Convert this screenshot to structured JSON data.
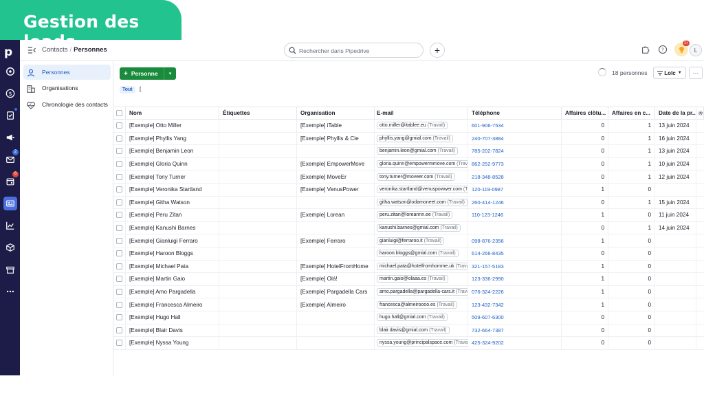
{
  "banner": {
    "title": "Gestion des leads"
  },
  "rail": {
    "logo": "p",
    "badges": {
      "mail": "2",
      "calendar": "6"
    }
  },
  "topbar": {
    "breadcrumb_parent": "Contacts",
    "breadcrumb_sep": "/",
    "breadcrumb_current": "Personnes",
    "search_placeholder": "Rechercher dans Pipedrive",
    "plus_label": "+",
    "bulb_badge": "1+",
    "avatar_initial": "L"
  },
  "sidenav": {
    "items": [
      {
        "label": "Personnes",
        "icon": "person-icon"
      },
      {
        "label": "Organisations",
        "icon": "building-icon"
      },
      {
        "label": "Chronologie des contacts",
        "icon": "heart-pulse-icon"
      }
    ]
  },
  "toolbar": {
    "add_plus": "+",
    "add_label": "Personne",
    "add_caret": "▾",
    "filter_tag": "Tout",
    "filter_cursor": "[",
    "count_label": "18 personnes",
    "owner_label": "Loïc",
    "more_label": "···"
  },
  "table": {
    "headers": {
      "nom": "Nom",
      "etiquettes": "Étiquettes",
      "organisation": "Organisation",
      "email": "E-mail",
      "telephone": "Téléphone",
      "affaires_cloturees": "Affaires clôtu...",
      "affaires_en_cours": "Affaires en c...",
      "date": "Date de la pr..."
    },
    "rows": [
      {
        "nom": "[Exemple] Otto Miller",
        "org": "[Exemple] iTable",
        "email": "otto.miller@itablee.eu",
        "email_tag": "(Travail)",
        "tel": "601-906-7534",
        "closed": "0",
        "open": "1",
        "date": "13 juin 2024"
      },
      {
        "nom": "[Exemple] Phyllis Yang",
        "org": "[Exemple] Phyllis & Cie",
        "email": "phyllis.yang@gmial.com",
        "email_tag": "(Travail)",
        "tel": "240-707-3884",
        "closed": "0",
        "open": "1",
        "date": "16 juin 2024"
      },
      {
        "nom": "[Exemple] Benjamin Leon",
        "org": "",
        "email": "benjamin.leon@gmial.com",
        "email_tag": "(Travail)",
        "tel": "785-202-7824",
        "closed": "0",
        "open": "1",
        "date": "13 juin 2024"
      },
      {
        "nom": "[Exemple] Gloria Quinn",
        "org": "[Exemple] EmpowerMove",
        "email": "gloria.quinn@empowermmove.com",
        "email_tag": "(Travail)",
        "tel": "862-252-9773",
        "closed": "0",
        "open": "1",
        "date": "10 juin 2024"
      },
      {
        "nom": "[Exemple] Tony Turner",
        "org": "[Exemple] MoveEr",
        "email": "tony.turner@moveer.com",
        "email_tag": "(Travail)",
        "tel": "218-348-8528",
        "closed": "0",
        "open": "1",
        "date": "12 juin 2024"
      },
      {
        "nom": "[Exemple] Veronika Startland",
        "org": "[Exemple] VenusPower",
        "email": "veronika.startland@venuspowwer.com",
        "email_tag": "(Travail)",
        "tel": "120-119-0987",
        "closed": "1",
        "open": "0",
        "date": ""
      },
      {
        "nom": "[Exemple] Githa Watson",
        "org": "",
        "email": "githa.watson@odamoneet.com",
        "email_tag": "(Travail)",
        "tel": "260-414-1246",
        "closed": "0",
        "open": "1",
        "date": "15 juin 2024"
      },
      {
        "nom": "[Exemple] Peru Zitan",
        "org": "[Exemple] Lorean",
        "email": "peru.zitan@loreannn.ee",
        "email_tag": "(Travail)",
        "tel": "110-123-1246",
        "closed": "1",
        "open": "0",
        "date": "11 juin 2024"
      },
      {
        "nom": "[Exemple] Kanushi Barnes",
        "org": "",
        "email": "kanushi.barnes@gmial.com",
        "email_tag": "(Travail)",
        "tel": "",
        "closed": "0",
        "open": "1",
        "date": "14 juin 2024"
      },
      {
        "nom": "[Exemple] Gianluigi Ferraro",
        "org": "[Exemple] Ferraro",
        "email": "gianluigi@ferraroo.it",
        "email_tag": "(Travail)",
        "tel": "098-876-2356",
        "closed": "1",
        "open": "0",
        "date": ""
      },
      {
        "nom": "[Exemple] Haroon Bloggs",
        "org": "",
        "email": "haroon.bloggs@gmial.com",
        "email_tag": "(Travail)",
        "tel": "614-266-8435",
        "closed": "0",
        "open": "0",
        "date": ""
      },
      {
        "nom": "[Exemple] Michael Pata",
        "org": "[Exemple] HotelFromHome",
        "email": "michael.pata@hotelfromhomme.uk",
        "email_tag": "(Travail)",
        "tel": "321-157-5183",
        "closed": "1",
        "open": "0",
        "date": ""
      },
      {
        "nom": "[Exemple] Martin Gaio",
        "org": "[Exemple] Olá!",
        "email": "martin.gaio@olaaa.es",
        "email_tag": "(Travail)",
        "tel": "123-336-2990",
        "closed": "1",
        "open": "0",
        "date": ""
      },
      {
        "nom": "[Exemple] Amo Pargadella",
        "org": "[Exemple] Pargadella Cars",
        "email": "amo.pargadella@pargadella-cars.it",
        "email_tag": "(Travail)",
        "tel": "076-324-2226",
        "closed": "1",
        "open": "0",
        "date": ""
      },
      {
        "nom": "[Exemple] Francesca Almeiro",
        "org": "[Exemple] Almeiro",
        "email": "francesca@almeiroooo.es",
        "email_tag": "(Travail)",
        "tel": "123-432-7342",
        "closed": "1",
        "open": "0",
        "date": ""
      },
      {
        "nom": "[Exemple] Hugo Hall",
        "org": "",
        "email": "hugo.hall@gmial.com",
        "email_tag": "(Travail)",
        "tel": "509-607-6300",
        "closed": "0",
        "open": "0",
        "date": ""
      },
      {
        "nom": "[Exemple] Blair Davis",
        "org": "",
        "email": "blair.davis@gmial.com",
        "email_tag": "(Travail)",
        "tel": "732-664-7387",
        "closed": "0",
        "open": "0",
        "date": ""
      },
      {
        "nom": "[Exemple] Nyssa Young",
        "org": "",
        "email": "nyssa.young@principalspace.com",
        "email_tag": "(Travail)",
        "tel": "425-324-9202",
        "closed": "0",
        "open": "0",
        "date": ""
      }
    ]
  },
  "colors": {
    "banner": "#22c38e",
    "rail": "#1d1b48",
    "primary_button": "#1a8a3c",
    "link": "#1f5fc7",
    "active_nav": "#e8f0fc"
  }
}
